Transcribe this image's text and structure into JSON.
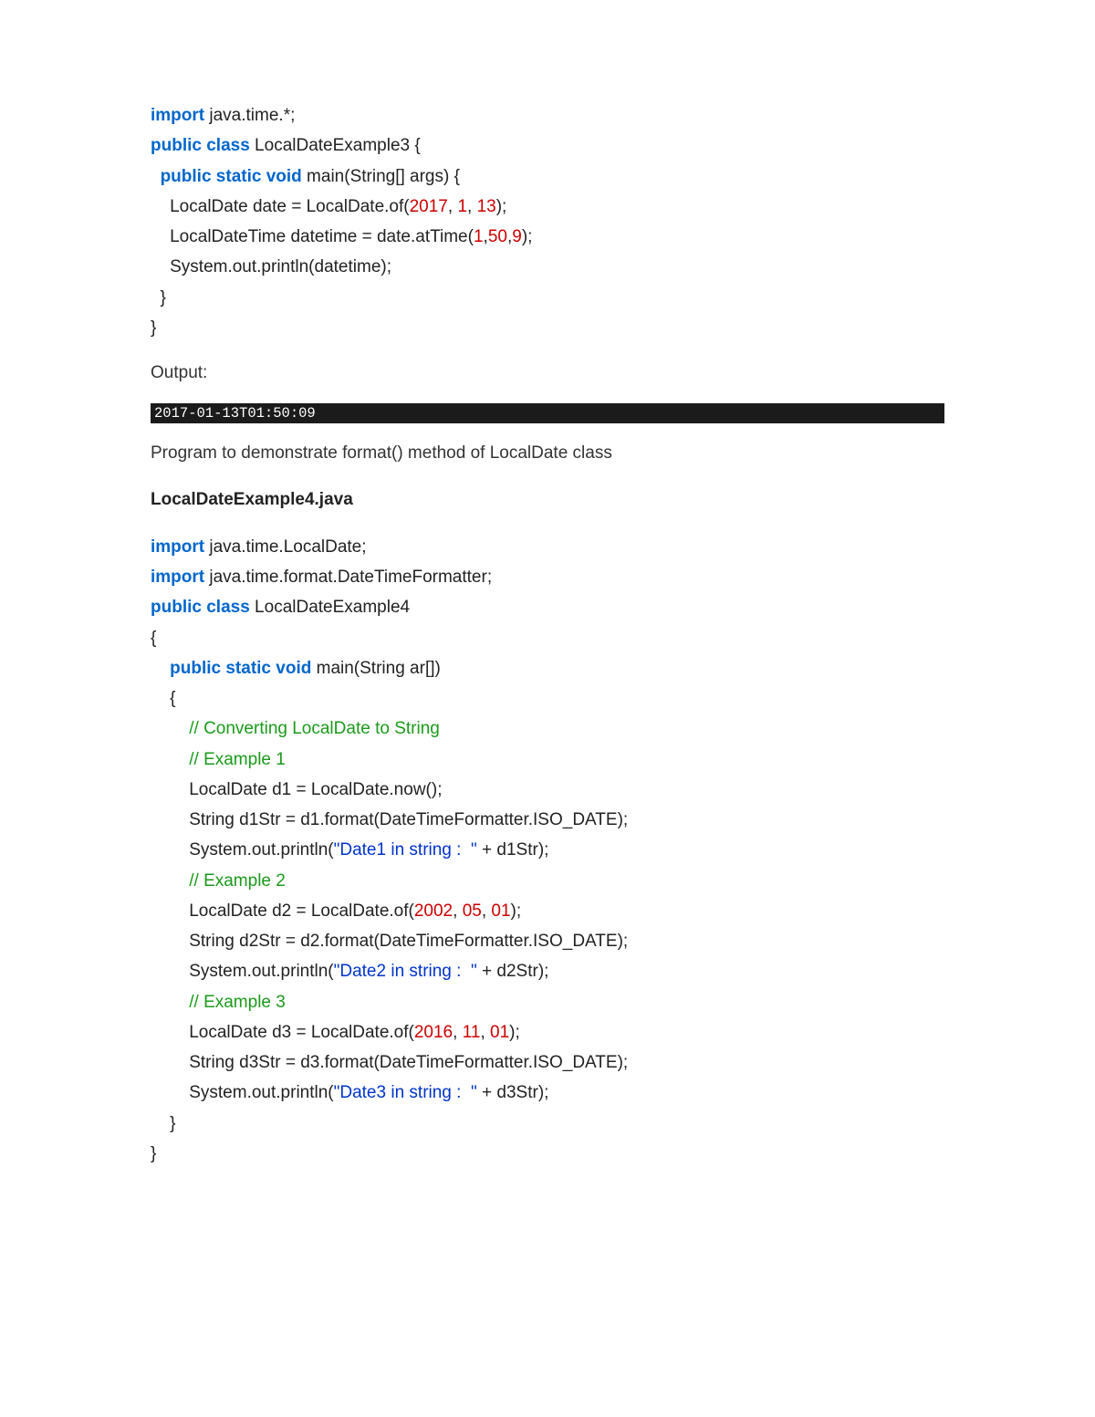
{
  "code1": {
    "l1a": "import",
    "l1b": " java.time.*;  ",
    "l2a": "public",
    "l2b": " ",
    "l2c": "class",
    "l2d": " LocalDateExample3 {  ",
    "l3a": "  ",
    "l3b": "public",
    "l3c": " ",
    "l3d": "static",
    "l3e": " ",
    "l3f": "void",
    "l3g": " main(String[] args) {  ",
    "l4a": "    LocalDate date = LocalDate.of(",
    "l4b": "2017",
    "l4c": ", ",
    "l4d": "1",
    "l4e": ", ",
    "l4f": "13",
    "l4g": ");  ",
    "l5a": "    LocalDateTime datetime = date.atTime(",
    "l5b": "1",
    "l5c": ",",
    "l5d": "50",
    "l5e": ",",
    "l5f": "9",
    "l5g": ");      ",
    "l6": "    System.out.println(datetime);    ",
    "l7": "  }    ",
    "l8": "}    "
  },
  "output_label": "Output:",
  "output_value": "2017-01-13T01:50:09",
  "desc": "Program to demonstrate format() method of LocalDate class",
  "heading": "LocalDateExample4.java",
  "code2": {
    "l1a": "import",
    "l1b": " java.time.LocalDate;   ",
    "l2a": "import",
    "l2b": " java.time.format.DateTimeFormatter;   ",
    "l3a": "public",
    "l3b": " ",
    "l3c": "class",
    "l3d": " LocalDateExample4   ",
    "l4": "{   ",
    "l5a": "    ",
    "l5b": "public",
    "l5c": " ",
    "l5d": "static",
    "l5e": " ",
    "l5f": "void",
    "l5g": " main(String ar[])   ",
    "l6": "    {   ",
    "l7a": "        ",
    "l7b": "// Converting LocalDate to String",
    "l8a": "        ",
    "l8b": "// Example 1  ",
    "l9": "        LocalDate d1 = LocalDate.now();   ",
    "l10": "        String d1Str = d1.format(DateTimeFormatter.ISO_DATE);   ",
    "l11a": "        System.out.println(",
    "l11b": "\"Date1 in string :  \"",
    "l11c": " + d1Str);   ",
    "l12a": "        ",
    "l12b": "// Example 2  ",
    "l13a": "        LocalDate d2 = LocalDate.of(",
    "l13b": "2002",
    "l13c": ", ",
    "l13d": "05",
    "l13e": ", ",
    "l13f": "01",
    "l13g": ");   ",
    "l14": "        String d2Str = d2.format(DateTimeFormatter.ISO_DATE);   ",
    "l15a": "        System.out.println(",
    "l15b": "\"Date2 in string :  \"",
    "l15c": " + d2Str);   ",
    "l16a": "        ",
    "l16b": "// Example 3  ",
    "l17a": "        LocalDate d3 = LocalDate.of(",
    "l17b": "2016",
    "l17c": ", ",
    "l17d": "11",
    "l17e": ", ",
    "l17f": "01",
    "l17g": ");   ",
    "l18": "        String d3Str = d3.format(DateTimeFormatter.ISO_DATE);   ",
    "l19a": "        System.out.println(",
    "l19b": "\"Date3 in string :  \"",
    "l19c": " + d3Str);   ",
    "l20": "    }   ",
    "l21": "}  "
  }
}
